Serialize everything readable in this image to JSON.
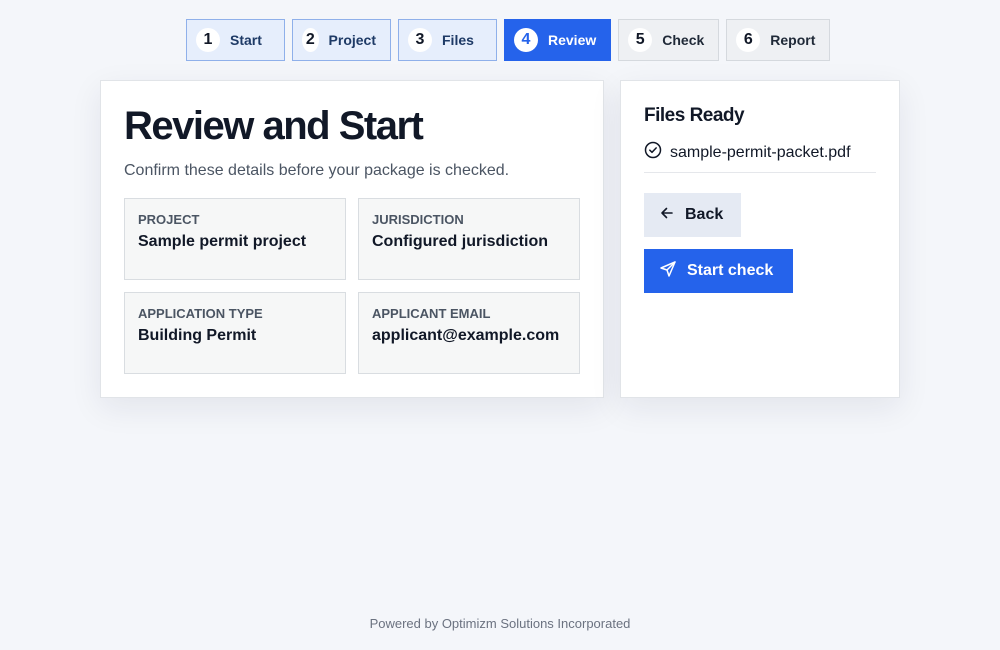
{
  "stepper": {
    "steps": [
      {
        "number": "1",
        "label": "Start",
        "state": "done"
      },
      {
        "number": "2",
        "label": "Project",
        "state": "done"
      },
      {
        "number": "3",
        "label": "Files",
        "state": "done"
      },
      {
        "number": "4",
        "label": "Review",
        "state": "active"
      },
      {
        "number": "5",
        "label": "Check",
        "state": "todo"
      },
      {
        "number": "6",
        "label": "Report",
        "state": "todo"
      }
    ]
  },
  "review": {
    "title": "Review and Start",
    "subtitle": "Confirm these details before your package is checked.",
    "fields": [
      {
        "label": "PROJECT",
        "value": "Sample permit project"
      },
      {
        "label": "JURISDICTION",
        "value": "Configured jurisdiction"
      },
      {
        "label": "APPLICATION TYPE",
        "value": "Building Permit"
      },
      {
        "label": "APPLICANT EMAIL",
        "value": "applicant@example.com"
      }
    ]
  },
  "files": {
    "title": "Files Ready",
    "items": [
      {
        "name": "sample-permit-packet.pdf",
        "icon": "check-circle-icon"
      }
    ]
  },
  "actions": {
    "back_label": "Back",
    "back_icon": "arrow-left-icon",
    "start_label": "Start check",
    "start_icon": "send-icon"
  },
  "footer": {
    "text": "Powered by Optimizm Solutions Incorporated"
  },
  "colors": {
    "accent": "#2563eb",
    "background": "#f4f6fa"
  }
}
